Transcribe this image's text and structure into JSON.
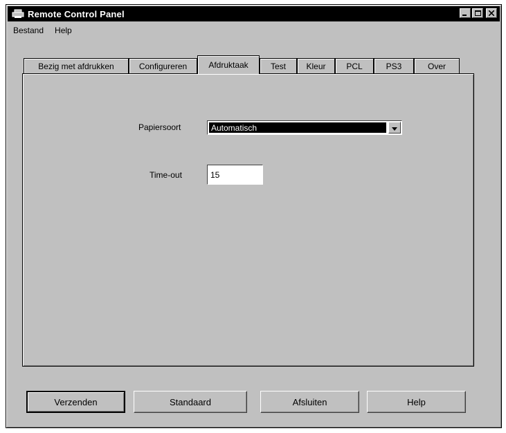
{
  "window": {
    "title": "Remote Control Panel",
    "icons": {
      "app": "printer-icon",
      "minimize": "minimize-icon",
      "maximize": "maximize-icon",
      "close": "close-icon"
    }
  },
  "menu": [
    {
      "label": "Bestand"
    },
    {
      "label": "Help"
    }
  ],
  "tabs": [
    {
      "label": "Bezig met afdrukken"
    },
    {
      "label": "Configureren"
    },
    {
      "label": "Afdruktaak",
      "active": true
    },
    {
      "label": "Test"
    },
    {
      "label": "Kleur"
    },
    {
      "label": "PCL"
    },
    {
      "label": "PS3"
    },
    {
      "label": "Over"
    }
  ],
  "form": {
    "papersoort_label": "Papiersoort",
    "papersoort_value": "Automatisch",
    "timeout_label": "Time-out",
    "timeout_value": "15"
  },
  "buttons": {
    "send": "Verzenden",
    "default": "Standaard",
    "close": "Afsluiten",
    "help": "Help"
  },
  "colors": {
    "face": "#c0c0c0",
    "titlebar": "#000000",
    "selection": "#000000"
  }
}
